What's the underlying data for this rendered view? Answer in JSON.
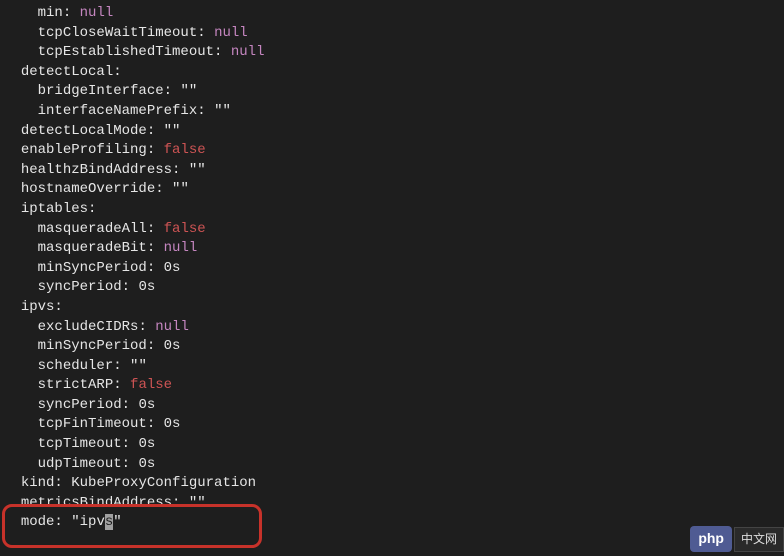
{
  "lines": [
    {
      "indent": 2,
      "key": "min",
      "value": {
        "type": "null",
        "text": "null"
      }
    },
    {
      "indent": 2,
      "key": "tcpCloseWaitTimeout",
      "value": {
        "type": "null",
        "text": "null"
      }
    },
    {
      "indent": 2,
      "key": "tcpEstablishedTimeout",
      "value": {
        "type": "null",
        "text": "null"
      }
    },
    {
      "indent": 1,
      "key": "detectLocal",
      "value": null
    },
    {
      "indent": 2,
      "key": "bridgeInterface",
      "value": {
        "type": "str",
        "text": "\"\""
      }
    },
    {
      "indent": 2,
      "key": "interfaceNamePrefix",
      "value": {
        "type": "str",
        "text": "\"\""
      }
    },
    {
      "indent": 1,
      "key": "detectLocalMode",
      "value": {
        "type": "str",
        "text": "\"\""
      }
    },
    {
      "indent": 1,
      "key": "enableProfiling",
      "value": {
        "type": "false",
        "text": "false"
      }
    },
    {
      "indent": 1,
      "key": "healthzBindAddress",
      "value": {
        "type": "str",
        "text": "\"\""
      }
    },
    {
      "indent": 1,
      "key": "hostnameOverride",
      "value": {
        "type": "str",
        "text": "\"\""
      }
    },
    {
      "indent": 1,
      "key": "iptables",
      "value": null
    },
    {
      "indent": 2,
      "key": "masqueradeAll",
      "value": {
        "type": "false",
        "text": "false"
      }
    },
    {
      "indent": 2,
      "key": "masqueradeBit",
      "value": {
        "type": "null",
        "text": "null"
      }
    },
    {
      "indent": 2,
      "key": "minSyncPeriod",
      "value": {
        "type": "num",
        "text": "0s"
      }
    },
    {
      "indent": 2,
      "key": "syncPeriod",
      "value": {
        "type": "num",
        "text": "0s"
      }
    },
    {
      "indent": 1,
      "key": "ipvs",
      "value": null
    },
    {
      "indent": 2,
      "key": "excludeCIDRs",
      "value": {
        "type": "null",
        "text": "null"
      }
    },
    {
      "indent": 2,
      "key": "minSyncPeriod",
      "value": {
        "type": "num",
        "text": "0s"
      }
    },
    {
      "indent": 2,
      "key": "scheduler",
      "value": {
        "type": "str",
        "text": "\"\""
      }
    },
    {
      "indent": 2,
      "key": "strictARP",
      "value": {
        "type": "false",
        "text": "false"
      }
    },
    {
      "indent": 2,
      "key": "syncPeriod",
      "value": {
        "type": "num",
        "text": "0s"
      }
    },
    {
      "indent": 2,
      "key": "tcpFinTimeout",
      "value": {
        "type": "num",
        "text": "0s"
      }
    },
    {
      "indent": 2,
      "key": "tcpTimeout",
      "value": {
        "type": "num",
        "text": "0s"
      }
    },
    {
      "indent": 2,
      "key": "udpTimeout",
      "value": {
        "type": "num",
        "text": "0s"
      }
    },
    {
      "indent": 1,
      "key": "kind",
      "value": {
        "type": "str",
        "text": "KubeProxyConfiguration"
      }
    },
    {
      "indent": 1,
      "key": "metricsBindAddress",
      "value": {
        "type": "str",
        "text": "\"\""
      }
    },
    {
      "indent": 1,
      "key": "mode",
      "value": {
        "type": "cursor",
        "text": "\"ipvs\"",
        "cursorPos": 4
      }
    }
  ],
  "highlighted_line_index": 26,
  "watermark": {
    "php": "php",
    "cn": "中文网"
  }
}
